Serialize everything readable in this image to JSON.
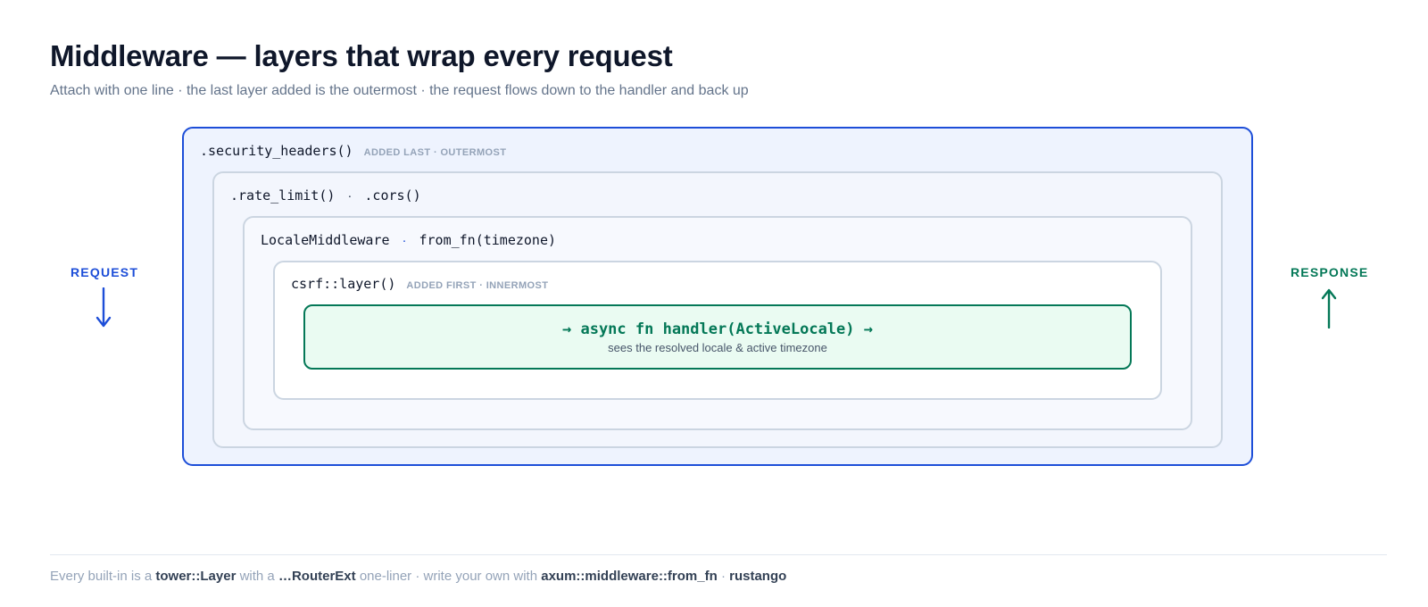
{
  "header": {
    "title": "Middleware — layers that wrap every request",
    "subtitle": "Attach with one line · the last layer added is the outermost · the request flows down to the handler and back up"
  },
  "flow": {
    "request_label": "REQUEST",
    "response_label": "RESPONSE",
    "request_color": "#1d4ed8",
    "response_color": "#047857",
    "request_icon": "arrow-down-icon",
    "response_icon": "arrow-up-icon"
  },
  "layers": [
    {
      "code": ".security_headers()",
      "tag": "ADDED LAST · OUTERMOST"
    },
    {
      "code_a": ".rate_limit()",
      "separator": "·",
      "code_b": ".cors()"
    },
    {
      "code_a": "LocaleMiddleware",
      "separator": "·",
      "code_b": "from_fn(timezone)"
    },
    {
      "code": "csrf::layer()",
      "tag": "ADDED FIRST · INNERMOST"
    }
  ],
  "handler": {
    "signature": "→ async fn handler(ActiveLocale) →",
    "note": "sees the resolved locale & active timezone"
  },
  "colors": {
    "outer_border": "#1d4ed8",
    "handler_border": "#047857",
    "handler_fill": "#eafbf2"
  },
  "footer": {
    "t1": "Every built-in is a",
    "b1": "tower::Layer",
    "t2": "with a",
    "b2": "…RouterExt",
    "t3": "one-liner · write your own with",
    "b3": "axum::middleware::from_fn",
    "t4": "·",
    "b4": "rustango"
  }
}
